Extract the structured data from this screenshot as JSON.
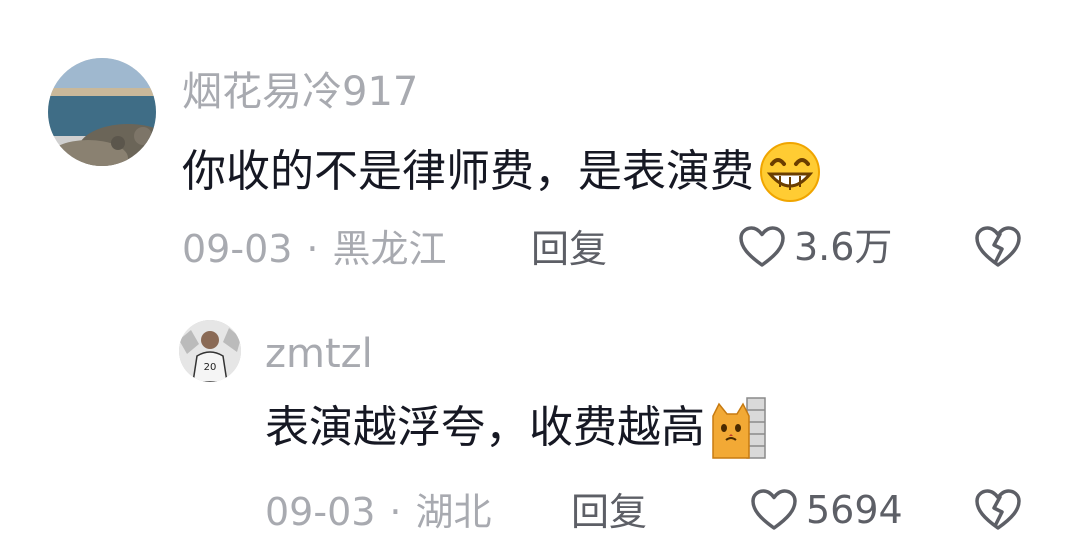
{
  "comments": [
    {
      "username": "烟花易冷917",
      "text": "你收的不是律师费，是表演费",
      "emoji": "grinning-face-emoji",
      "date": "09-03",
      "separator": "·",
      "location": "黑龙江",
      "reply_label": "回复",
      "likes": "3.6万"
    }
  ],
  "replies": [
    {
      "username": "zmtzl",
      "text": "表演越浮夸，收费越高",
      "emoji": "cat-behind-wall-emoji",
      "date": "09-03",
      "separator": "·",
      "location": "湖北",
      "reply_label": "回复",
      "likes": "5694"
    }
  ],
  "icons": {
    "like": "heart-outline-icon",
    "dislike": "broken-heart-icon"
  },
  "colors": {
    "text_primary": "#161823",
    "text_secondary": "#a8aab0",
    "action_text": "#5d5f66"
  }
}
